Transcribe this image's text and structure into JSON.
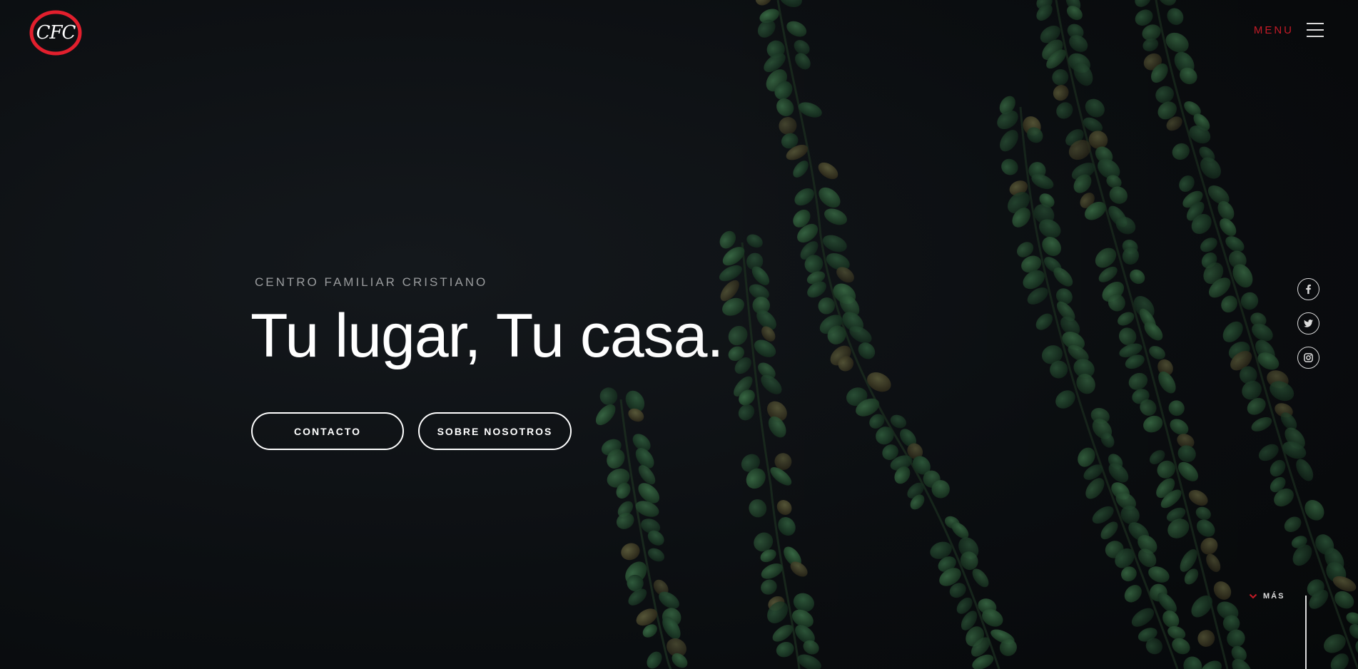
{
  "brand": {
    "logo_text": "CFC",
    "accent_color": "#e21f2d"
  },
  "nav": {
    "menu_label": "MENU"
  },
  "hero": {
    "eyebrow": "CENTRO FAMILIAR CRISTIANO",
    "headline": "Tu lugar, Tu casa.",
    "buttons": [
      {
        "label": "CONTACTO"
      },
      {
        "label": "SOBRE NOSOTROS"
      }
    ]
  },
  "social": {
    "icons": [
      "facebook-icon",
      "twitter-icon",
      "instagram-icon"
    ]
  },
  "scroll": {
    "label": "MÁS"
  }
}
